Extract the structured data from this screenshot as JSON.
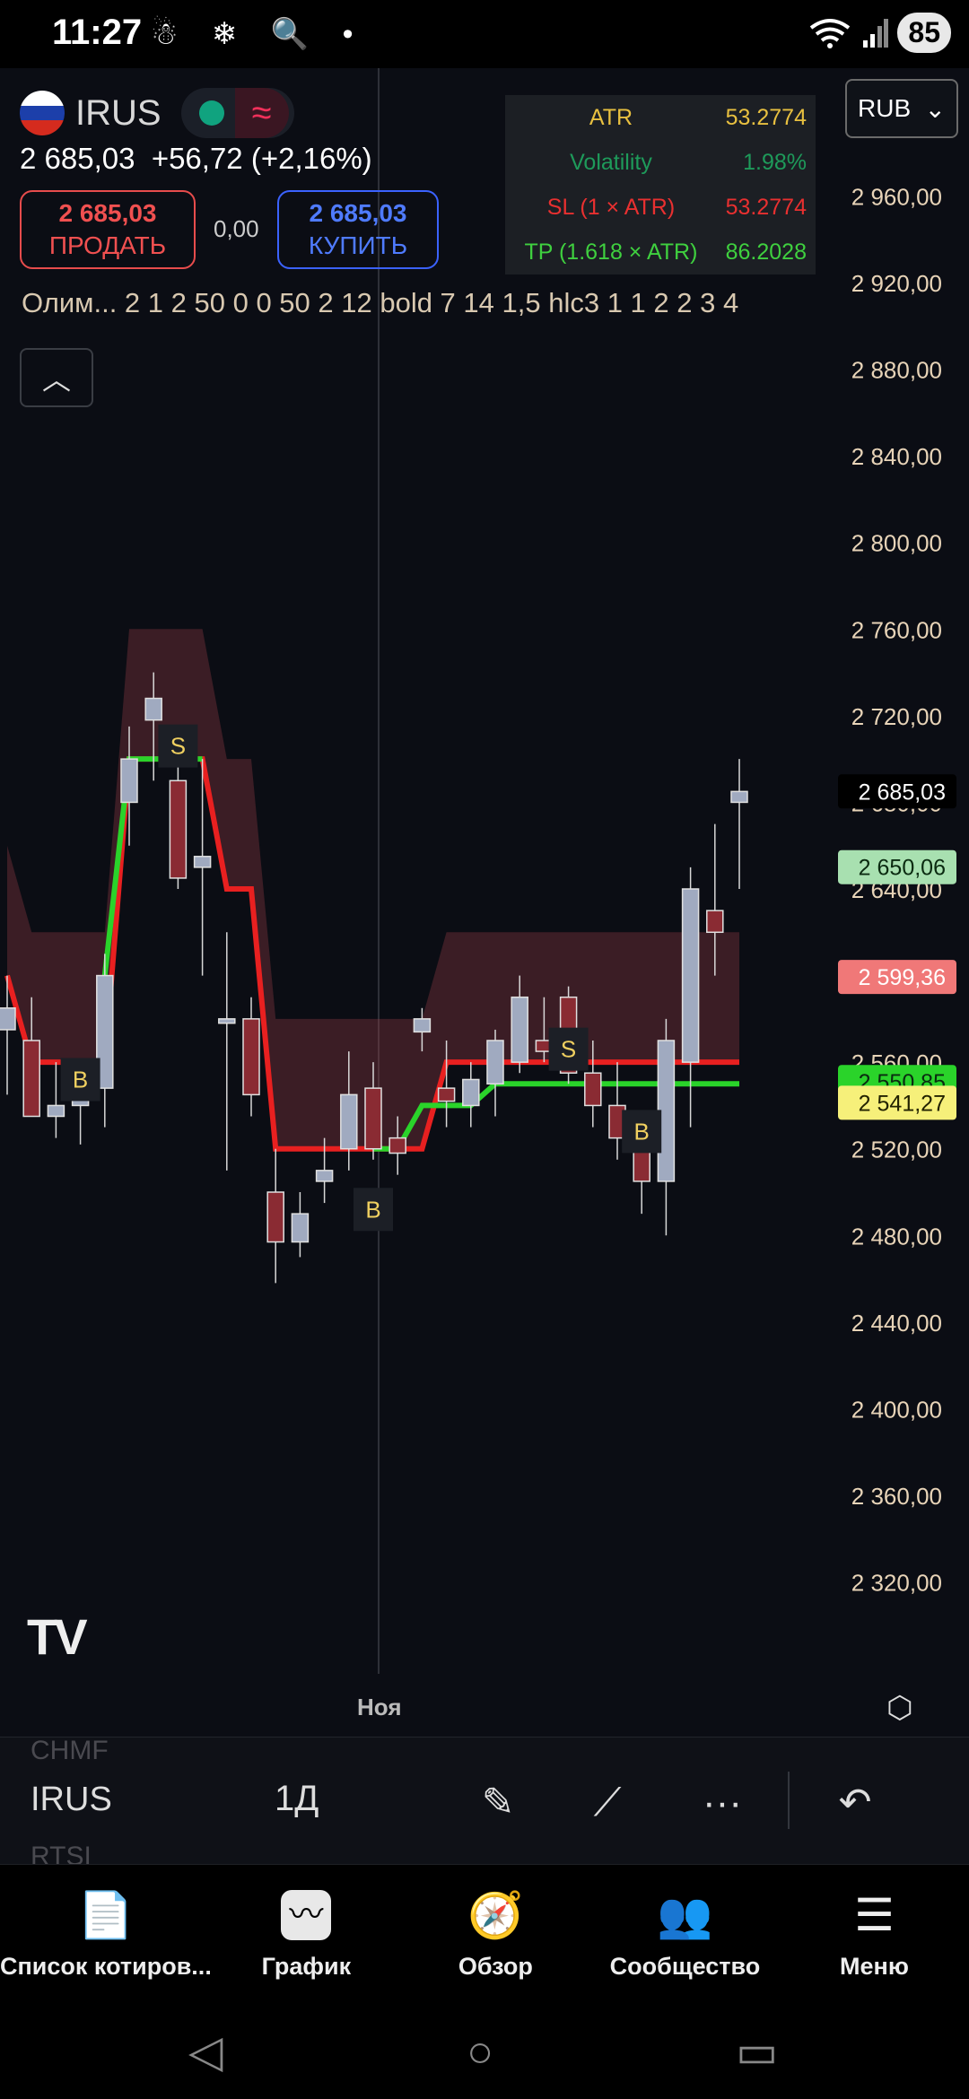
{
  "status_bar": {
    "time": "11:27",
    "left_icons": "☃ ❄ 🔍 •",
    "signal": "📶",
    "battery": "85"
  },
  "symbol": {
    "name": "IRUS",
    "flag_colors": [
      "#ffffff",
      "#1c3faa",
      "#d52b1e"
    ],
    "last_price": "2 685,03",
    "change": "+56,72 (+2,16%)"
  },
  "trade": {
    "sell_price": "2 685,03",
    "sell_label": "ПРОДАТЬ",
    "spread": "0,00",
    "buy_price": "2 685,03",
    "buy_label": "КУПИТЬ"
  },
  "currency_select": "RUB",
  "info_table": [
    {
      "key": "ATR",
      "value": "53.2774",
      "color": "#e8c040"
    },
    {
      "key": "Volatility",
      "value": "1.98%",
      "color": "#1e9a5a"
    },
    {
      "key": "SL (1 × ATR)",
      "value": "53.2774",
      "color": "#e83030"
    },
    {
      "key": "TP (1.618 × ATR)",
      "value": "86.2028",
      "color": "#3fd03f"
    }
  ],
  "indicator_line": "Олим... 2 1 2 50 0 0 50 2 12 bold 7 14 1,5 hlc3 1 1 2 2 3 4",
  "collapse_icon": "chevron-up-icon",
  "chart_data": {
    "type": "candlestick",
    "ylim": [
      2290,
      2990
    ],
    "y_ticks": [
      "2 960,00",
      "2 920,00",
      "2 880,00",
      "2 840,00",
      "2 800,00",
      "2 760,00",
      "2 720,00",
      "2 680,00",
      "2 640,00",
      "2 600,00",
      "2 560,00",
      "2 520,00",
      "2 480,00",
      "2 440,00",
      "2 400,00",
      "2 360,00",
      "2 320,00"
    ],
    "y_tick_values": [
      2960,
      2920,
      2880,
      2840,
      2800,
      2760,
      2720,
      2680,
      2640,
      2600,
      2560,
      2520,
      2480,
      2440,
      2400,
      2360,
      2320
    ],
    "x_label": "Ноя",
    "price_labels": [
      {
        "text": "2 685,03",
        "value": 2685.03,
        "bg": "#000000",
        "fg": "#ffffff"
      },
      {
        "text": "2 650,06",
        "value": 2650.06,
        "bg": "#a8e0b0",
        "fg": "#0a2a10"
      },
      {
        "text": "2 599,36",
        "value": 2599.36,
        "bg": "#f07878",
        "fg": "#ffffff"
      },
      {
        "text": "2 550,85",
        "value": 2550.85,
        "bg": "#2ad32a",
        "fg": "#0a2a10"
      },
      {
        "text": "2 541,27",
        "value": 2541.27,
        "bg": "#f6f07a",
        "fg": "#222200"
      }
    ],
    "candles": [
      {
        "o": 2575,
        "h": 2600,
        "l": 2545,
        "c": 2585
      },
      {
        "o": 2570,
        "h": 2590,
        "l": 2535,
        "c": 2535
      },
      {
        "o": 2535,
        "h": 2560,
        "l": 2525,
        "c": 2540
      },
      {
        "o": 2540,
        "h": 2555,
        "l": 2522,
        "c": 2552
      },
      {
        "o": 2548,
        "h": 2610,
        "l": 2530,
        "c": 2600
      },
      {
        "o": 2680,
        "h": 2715,
        "l": 2660,
        "c": 2700
      },
      {
        "o": 2718,
        "h": 2740,
        "l": 2690,
        "c": 2728
      },
      {
        "o": 2690,
        "h": 2700,
        "l": 2640,
        "c": 2645
      },
      {
        "o": 2650,
        "h": 2700,
        "l": 2600,
        "c": 2655
      },
      {
        "o": 2578,
        "h": 2620,
        "l": 2510,
        "c": 2580
      },
      {
        "o": 2580,
        "h": 2590,
        "l": 2535,
        "c": 2545
      },
      {
        "o": 2500,
        "h": 2520,
        "l": 2458,
        "c": 2477
      },
      {
        "o": 2477,
        "h": 2500,
        "l": 2470,
        "c": 2490
      },
      {
        "o": 2505,
        "h": 2525,
        "l": 2495,
        "c": 2510
      },
      {
        "o": 2520,
        "h": 2565,
        "l": 2510,
        "c": 2545
      },
      {
        "o": 2548,
        "h": 2560,
        "l": 2515,
        "c": 2520
      },
      {
        "o": 2525,
        "h": 2535,
        "l": 2508,
        "c": 2518
      },
      {
        "o": 2574,
        "h": 2585,
        "l": 2565,
        "c": 2580
      },
      {
        "o": 2548,
        "h": 2570,
        "l": 2530,
        "c": 2542
      },
      {
        "o": 2540,
        "h": 2560,
        "l": 2530,
        "c": 2552
      },
      {
        "o": 2550,
        "h": 2575,
        "l": 2535,
        "c": 2570
      },
      {
        "o": 2560,
        "h": 2600,
        "l": 2555,
        "c": 2590
      },
      {
        "o": 2570,
        "h": 2590,
        "l": 2560,
        "c": 2565
      },
      {
        "o": 2590,
        "h": 2595,
        "l": 2550,
        "c": 2555
      },
      {
        "o": 2555,
        "h": 2570,
        "l": 2530,
        "c": 2540
      },
      {
        "o": 2540,
        "h": 2560,
        "l": 2515,
        "c": 2525
      },
      {
        "o": 2520,
        "h": 2530,
        "l": 2490,
        "c": 2505
      },
      {
        "o": 2505,
        "h": 2580,
        "l": 2480,
        "c": 2570
      },
      {
        "o": 2560,
        "h": 2650,
        "l": 2530,
        "c": 2640
      },
      {
        "o": 2630,
        "h": 2670,
        "l": 2600,
        "c": 2620
      },
      {
        "o": 2680,
        "h": 2700,
        "l": 2640,
        "c": 2685
      }
    ],
    "signals": [
      {
        "text": "S",
        "candle": 7,
        "value": 2706
      },
      {
        "text": "B",
        "candle": 3,
        "value": 2552
      },
      {
        "text": "B",
        "candle": 15,
        "value": 2492
      },
      {
        "text": "S",
        "candle": 23,
        "value": 2566
      },
      {
        "text": "B",
        "candle": 26,
        "value": 2528
      }
    ],
    "series": [
      {
        "name": "",
        "color": "#e82020",
        "values": [
          2600,
          2560,
          2560,
          2560,
          2560,
          2700,
          2700,
          2700,
          2700,
          2640,
          2640,
          2520,
          2520,
          2520,
          2520,
          2520,
          2520,
          2520,
          2560,
          2560,
          2560,
          2560,
          2560,
          2560,
          2560,
          2560,
          2560,
          2560,
          2560,
          2560,
          2560
        ]
      },
      {
        "name": "",
        "color": "#2ad32a",
        "values": [
          null,
          null,
          null,
          null,
          2600,
          2700,
          2700,
          2700,
          2700,
          null,
          null,
          null,
          null,
          null,
          null,
          2520,
          2520,
          2540,
          2540,
          2540,
          2550,
          2550,
          2550,
          2550,
          2550,
          2550,
          2550,
          2550,
          2550,
          2550,
          2550
        ]
      }
    ]
  },
  "toolbar": {
    "prev_symbol": "CHMF",
    "symbol": "IRUS",
    "next_symbol": "RTSI",
    "interval": "1Д",
    "icons": [
      "pen-icon",
      "trend-line-icon",
      "more-icon",
      "undo-icon"
    ]
  },
  "bottom_nav": [
    {
      "label": "Список котиров...",
      "icon": "📄"
    },
    {
      "label": "График",
      "icon": "〰"
    },
    {
      "label": "Обзор",
      "icon": "🧭"
    },
    {
      "label": "Сообщество",
      "icon": "👥"
    },
    {
      "label": "Меню",
      "icon": "☰"
    }
  ],
  "system_nav": [
    "◁",
    "○",
    "▭"
  ]
}
